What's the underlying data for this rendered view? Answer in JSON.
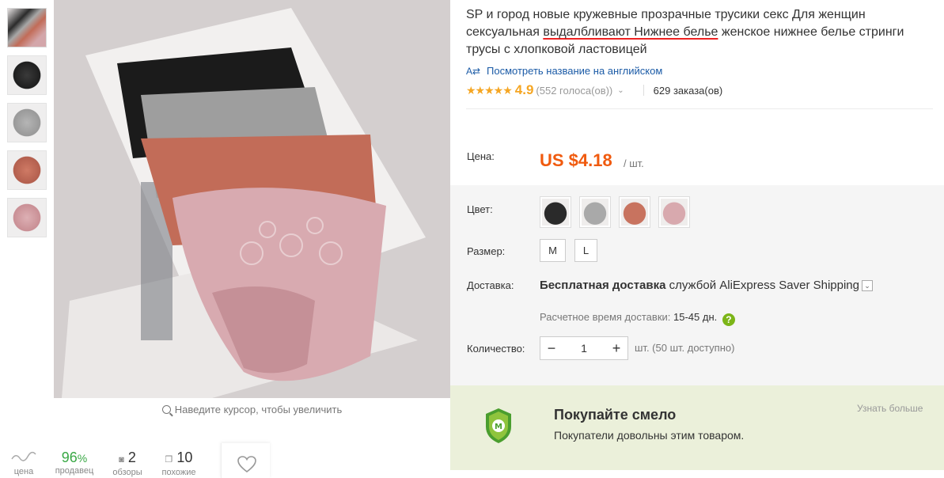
{
  "product": {
    "title_part1": "SP и город новые кружевные прозрачные трусики секс Для женщин сексуальная ",
    "title_underlined": "выдалбливают Нижнее белье",
    "title_part2": " женское нижнее белье стринги трусы с хлопковой ластовицей",
    "translate_link": "Посмотреть название на английском",
    "rating_value": "4.9",
    "rating_votes": "(552 голоса(ов))",
    "orders": "629 заказа(ов)"
  },
  "price": {
    "label": "Цена:",
    "value": "US $4.18",
    "unit": "/ шт."
  },
  "options": {
    "color_label": "Цвет:",
    "colors": [
      "#2a2a2a",
      "#a9a9a9",
      "#c8735f",
      "#d8a9ae"
    ],
    "size_label": "Размер:",
    "sizes": [
      "M",
      "L"
    ],
    "shipping_label": "Доставка:",
    "shipping_bold": "Бесплатная доставка",
    "shipping_rest": " службой AliExpress Saver Shipping",
    "eta_label": "Расчетное время доставки:",
    "eta_value": "15-45 дн.",
    "help_icon": "?",
    "qty_label": "Количество:",
    "qty_value": "1",
    "qty_minus": "−",
    "qty_plus": "+",
    "availability": "шт. (50 шт. доступно)"
  },
  "gallery": {
    "zoom_hint": "Наведите курсор, чтобы увеличить",
    "thumb_colors": [
      "#cdb4b6",
      "#2b2b2b",
      "#a7a7a7",
      "#c26c58",
      "#d3a6aa"
    ]
  },
  "stats": {
    "price_label": "цена",
    "seller_value": "96",
    "seller_unit": "%",
    "seller_label": "продавец",
    "reviews_value": "2",
    "reviews_label": "обзоры",
    "similar_value": "10",
    "similar_label": "похожие"
  },
  "buy_safe": {
    "title": "Покупайте смело",
    "subtitle": "Покупатели довольны этим товаром.",
    "more": "Узнать больше"
  }
}
